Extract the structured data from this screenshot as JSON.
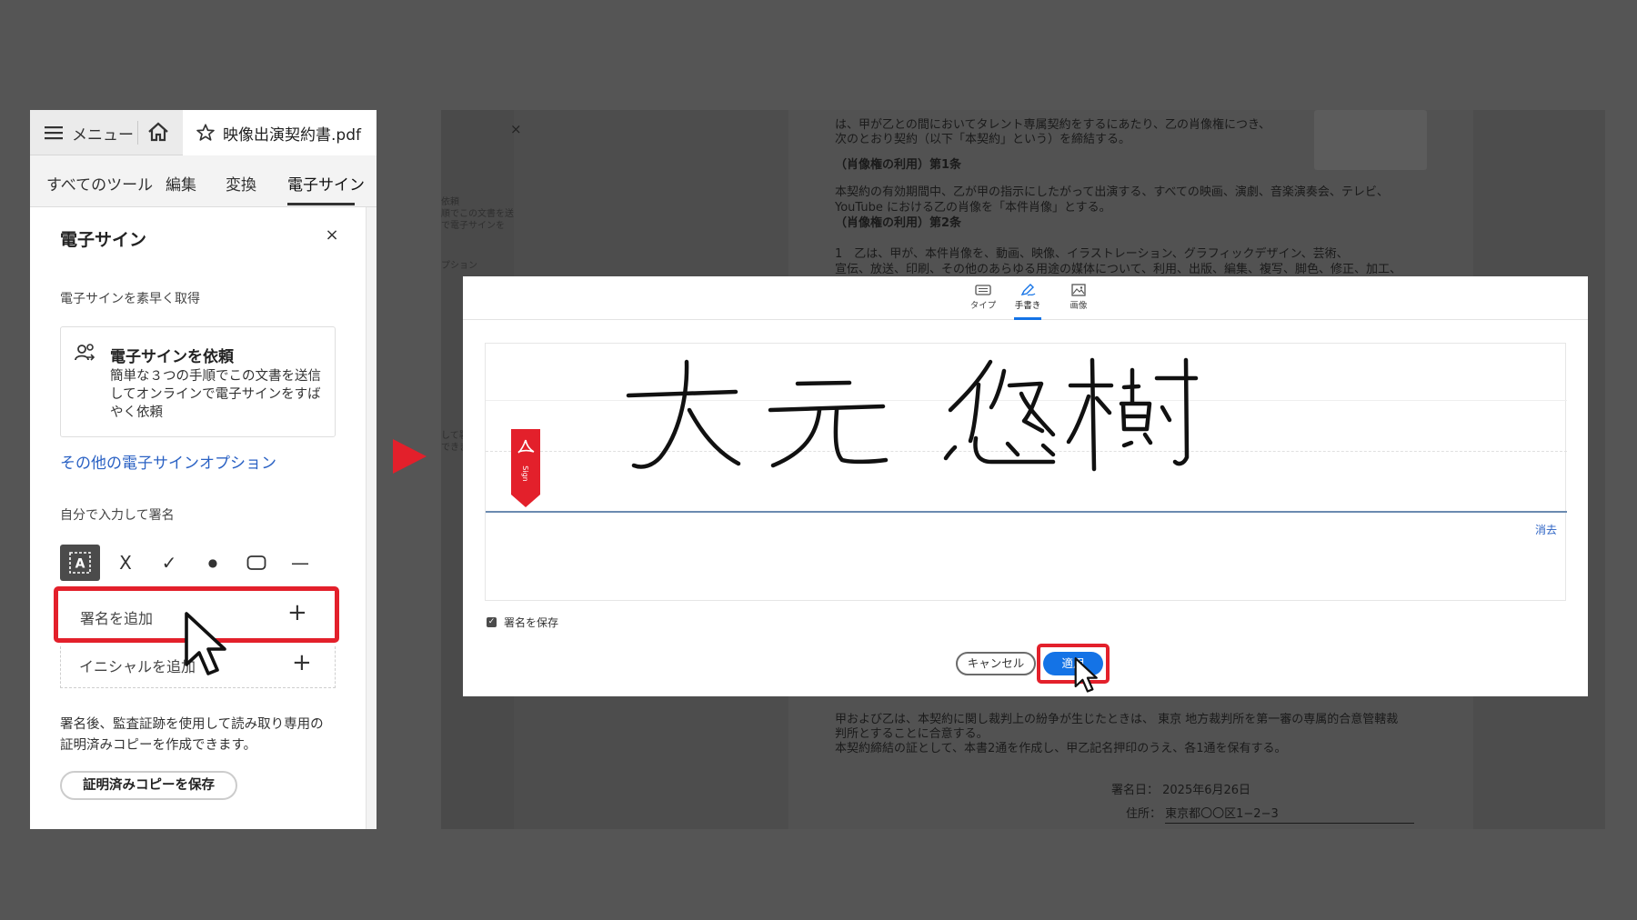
{
  "left_panel": {
    "menu_label": "メニュー",
    "file_name": "映像出演契約書.pdf",
    "tabs": [
      {
        "label": "すべてのツール"
      },
      {
        "label": "編集"
      },
      {
        "label": "変換"
      },
      {
        "label": "電子サイン"
      }
    ],
    "active_tab": "電子サイン",
    "panel_title": "電子サイン",
    "close_symbol": "×",
    "quick_section_label": "電子サインを素早く取得",
    "request_card": {
      "title": "電子サインを依頼",
      "description": "簡単な３つの手順でこの文書を送信してオンラインで電子サインをすばやく依頼"
    },
    "other_options_link": "その他の電子サインオプション",
    "self_sign_label": "自分で入力して署名",
    "tools": [
      "text-tool",
      "cross-mark-tool",
      "check-mark-tool",
      "dot-tool",
      "rectangle-tool",
      "line-tool"
    ],
    "tool_glyphs": {
      "cross": "X",
      "check": "✓",
      "dot": "●",
      "line": "—"
    },
    "add_signature_label": "署名を追加",
    "add_initials_label": "イニシャルを追加",
    "plus_symbol": "+",
    "certified_description": "署名後、監査証跡を使用して読み取り専用の証明済みコピーを作成できます。",
    "certified_button": "証明済みコピーを保存",
    "highlight_color": "#e3202b"
  },
  "document": {
    "lines_top": [
      "は、甲が乙との間においてタレント専属契約をするにあたり、乙の肖像権につき、",
      "次のとおり契約（以下「本契約」という）を締結する。"
    ],
    "heading_1": "（肖像権の利用）第1条",
    "article_1": [
      "本契約の有効期間中、乙が甲の指示にしたがって出演する、すべての映画、演劇、音楽演奏会、テレビ、",
      "YouTube における乙の肖像を「本件肖像」とする。"
    ],
    "heading_2": "（肖像権の利用）第2条",
    "article_2": [
      "1　乙は、甲が、本件肖像を、動画、映像、イラストレーション、グラフィックデザイン、芸術、",
      "宣伝、放送、印刷、その他のあらゆる用途の媒体について、利用、出版、編集、複写、脚色、修正、加工、"
    ],
    "lines_bottom": [
      "甲および乙は、本契約に関し裁判上の紛争が生じたときは、 東京 地方裁判所を第一審の専属的合意管轄裁",
      "判所とすることに合意する。",
      "本契約締結の証として、本書2通を作成し、甲乙記名押印のうえ、各1通を保有する。"
    ],
    "sign_date": "署名日： 2025年6月26日",
    "address": "住所： 東京都〇〇区1−2−3",
    "sidebar_ghost": [
      "依頼",
      "順でこの文書を送",
      "で電子サインを",
      "プション",
      "して署",
      "できま"
    ],
    "sidebar_close": "×"
  },
  "dialog": {
    "tabs": [
      {
        "label": "タイプ",
        "icon": "keyboard-icon"
      },
      {
        "label": "手書き",
        "icon": "pen-icon"
      },
      {
        "label": "画像",
        "icon": "image-icon"
      }
    ],
    "active_tab": "手書き",
    "signature_text": "大元 悠樹",
    "sign_flag_text": "Sign",
    "clear_link": "消去",
    "save_signature_label": "署名を保存",
    "save_signature_checked": true,
    "cancel_button": "キャンセル",
    "apply_button": "適用",
    "accent_color": "#1473e6"
  }
}
